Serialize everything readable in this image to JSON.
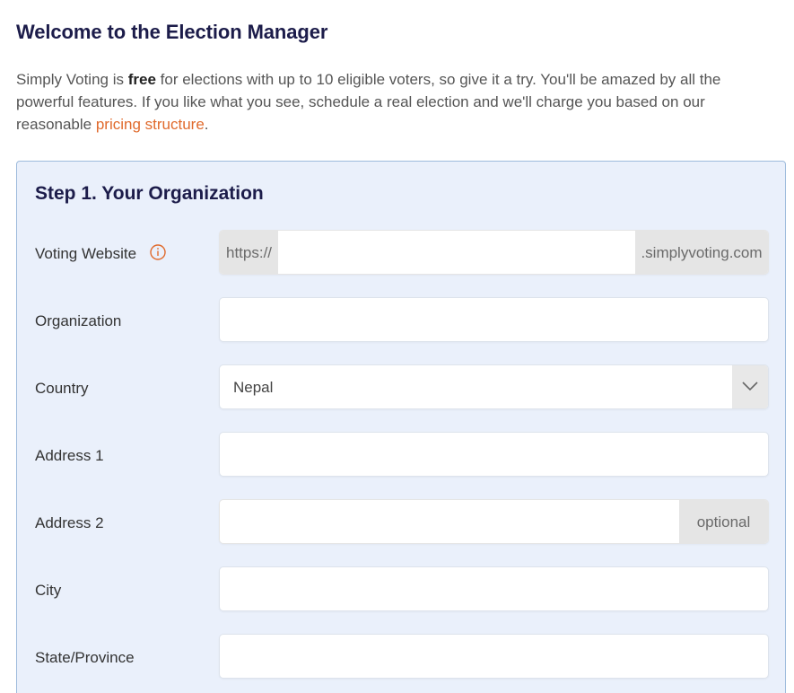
{
  "header": {
    "title": "Welcome to the Election Manager"
  },
  "intro": {
    "text_1": "Simply Voting is ",
    "bold": "free",
    "text_2": " for elections with up to 10 eligible voters, so give it a try. You'll be amazed by all the powerful features. If you like what you see, schedule a real election and we'll charge you based on our reasonable ",
    "link": "pricing structure",
    "text_3": "."
  },
  "step1": {
    "title": "Step 1. Your Organization",
    "fields": {
      "voting_website": {
        "label": "Voting Website",
        "prefix": "https://",
        "suffix": ".simplyvoting.com",
        "value": "",
        "icon": "info-icon"
      },
      "organization": {
        "label": "Organization",
        "value": ""
      },
      "country": {
        "label": "Country",
        "value": "Nepal",
        "icon": "chevron-down-icon"
      },
      "address1": {
        "label": "Address 1",
        "value": ""
      },
      "address2": {
        "label": "Address 2",
        "value": "",
        "suffix": "optional"
      },
      "city": {
        "label": "City",
        "value": ""
      },
      "state": {
        "label": "State/Province",
        "value": ""
      }
    }
  },
  "colors": {
    "title": "#1c1c4a",
    "link": "#e06a2c",
    "panel_bg": "#eaf0fb",
    "panel_border": "#9dbbdc",
    "addon_bg": "#e5e5e5"
  }
}
